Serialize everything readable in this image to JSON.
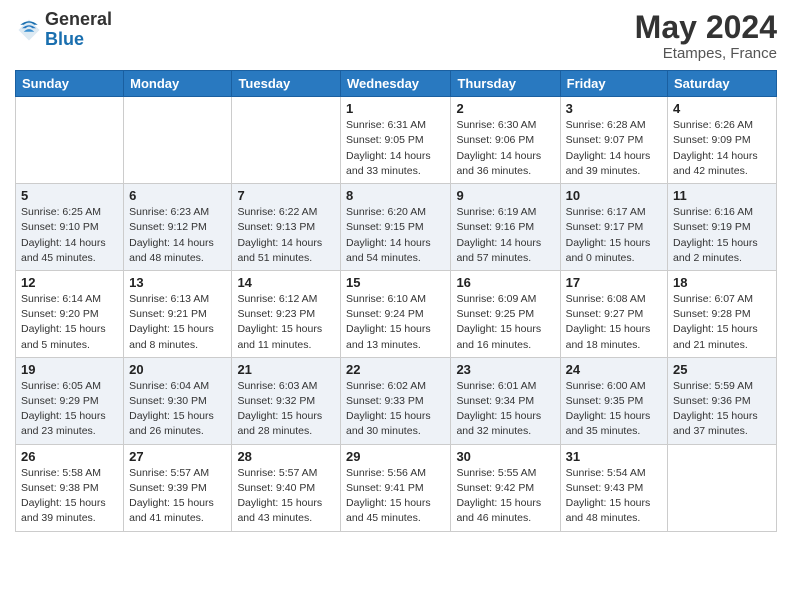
{
  "logo": {
    "general": "General",
    "blue": "Blue"
  },
  "header": {
    "month_year": "May 2024",
    "location": "Etampes, France"
  },
  "weekdays": [
    "Sunday",
    "Monday",
    "Tuesday",
    "Wednesday",
    "Thursday",
    "Friday",
    "Saturday"
  ],
  "weeks": [
    [
      {
        "day": "",
        "sunrise": "",
        "sunset": "",
        "daylight": ""
      },
      {
        "day": "",
        "sunrise": "",
        "sunset": "",
        "daylight": ""
      },
      {
        "day": "",
        "sunrise": "",
        "sunset": "",
        "daylight": ""
      },
      {
        "day": "1",
        "sunrise": "Sunrise: 6:31 AM",
        "sunset": "Sunset: 9:05 PM",
        "daylight": "Daylight: 14 hours and 33 minutes."
      },
      {
        "day": "2",
        "sunrise": "Sunrise: 6:30 AM",
        "sunset": "Sunset: 9:06 PM",
        "daylight": "Daylight: 14 hours and 36 minutes."
      },
      {
        "day": "3",
        "sunrise": "Sunrise: 6:28 AM",
        "sunset": "Sunset: 9:07 PM",
        "daylight": "Daylight: 14 hours and 39 minutes."
      },
      {
        "day": "4",
        "sunrise": "Sunrise: 6:26 AM",
        "sunset": "Sunset: 9:09 PM",
        "daylight": "Daylight: 14 hours and 42 minutes."
      }
    ],
    [
      {
        "day": "5",
        "sunrise": "Sunrise: 6:25 AM",
        "sunset": "Sunset: 9:10 PM",
        "daylight": "Daylight: 14 hours and 45 minutes."
      },
      {
        "day": "6",
        "sunrise": "Sunrise: 6:23 AM",
        "sunset": "Sunset: 9:12 PM",
        "daylight": "Daylight: 14 hours and 48 minutes."
      },
      {
        "day": "7",
        "sunrise": "Sunrise: 6:22 AM",
        "sunset": "Sunset: 9:13 PM",
        "daylight": "Daylight: 14 hours and 51 minutes."
      },
      {
        "day": "8",
        "sunrise": "Sunrise: 6:20 AM",
        "sunset": "Sunset: 9:15 PM",
        "daylight": "Daylight: 14 hours and 54 minutes."
      },
      {
        "day": "9",
        "sunrise": "Sunrise: 6:19 AM",
        "sunset": "Sunset: 9:16 PM",
        "daylight": "Daylight: 14 hours and 57 minutes."
      },
      {
        "day": "10",
        "sunrise": "Sunrise: 6:17 AM",
        "sunset": "Sunset: 9:17 PM",
        "daylight": "Daylight: 15 hours and 0 minutes."
      },
      {
        "day": "11",
        "sunrise": "Sunrise: 6:16 AM",
        "sunset": "Sunset: 9:19 PM",
        "daylight": "Daylight: 15 hours and 2 minutes."
      }
    ],
    [
      {
        "day": "12",
        "sunrise": "Sunrise: 6:14 AM",
        "sunset": "Sunset: 9:20 PM",
        "daylight": "Daylight: 15 hours and 5 minutes."
      },
      {
        "day": "13",
        "sunrise": "Sunrise: 6:13 AM",
        "sunset": "Sunset: 9:21 PM",
        "daylight": "Daylight: 15 hours and 8 minutes."
      },
      {
        "day": "14",
        "sunrise": "Sunrise: 6:12 AM",
        "sunset": "Sunset: 9:23 PM",
        "daylight": "Daylight: 15 hours and 11 minutes."
      },
      {
        "day": "15",
        "sunrise": "Sunrise: 6:10 AM",
        "sunset": "Sunset: 9:24 PM",
        "daylight": "Daylight: 15 hours and 13 minutes."
      },
      {
        "day": "16",
        "sunrise": "Sunrise: 6:09 AM",
        "sunset": "Sunset: 9:25 PM",
        "daylight": "Daylight: 15 hours and 16 minutes."
      },
      {
        "day": "17",
        "sunrise": "Sunrise: 6:08 AM",
        "sunset": "Sunset: 9:27 PM",
        "daylight": "Daylight: 15 hours and 18 minutes."
      },
      {
        "day": "18",
        "sunrise": "Sunrise: 6:07 AM",
        "sunset": "Sunset: 9:28 PM",
        "daylight": "Daylight: 15 hours and 21 minutes."
      }
    ],
    [
      {
        "day": "19",
        "sunrise": "Sunrise: 6:05 AM",
        "sunset": "Sunset: 9:29 PM",
        "daylight": "Daylight: 15 hours and 23 minutes."
      },
      {
        "day": "20",
        "sunrise": "Sunrise: 6:04 AM",
        "sunset": "Sunset: 9:30 PM",
        "daylight": "Daylight: 15 hours and 26 minutes."
      },
      {
        "day": "21",
        "sunrise": "Sunrise: 6:03 AM",
        "sunset": "Sunset: 9:32 PM",
        "daylight": "Daylight: 15 hours and 28 minutes."
      },
      {
        "day": "22",
        "sunrise": "Sunrise: 6:02 AM",
        "sunset": "Sunset: 9:33 PM",
        "daylight": "Daylight: 15 hours and 30 minutes."
      },
      {
        "day": "23",
        "sunrise": "Sunrise: 6:01 AM",
        "sunset": "Sunset: 9:34 PM",
        "daylight": "Daylight: 15 hours and 32 minutes."
      },
      {
        "day": "24",
        "sunrise": "Sunrise: 6:00 AM",
        "sunset": "Sunset: 9:35 PM",
        "daylight": "Daylight: 15 hours and 35 minutes."
      },
      {
        "day": "25",
        "sunrise": "Sunrise: 5:59 AM",
        "sunset": "Sunset: 9:36 PM",
        "daylight": "Daylight: 15 hours and 37 minutes."
      }
    ],
    [
      {
        "day": "26",
        "sunrise": "Sunrise: 5:58 AM",
        "sunset": "Sunset: 9:38 PM",
        "daylight": "Daylight: 15 hours and 39 minutes."
      },
      {
        "day": "27",
        "sunrise": "Sunrise: 5:57 AM",
        "sunset": "Sunset: 9:39 PM",
        "daylight": "Daylight: 15 hours and 41 minutes."
      },
      {
        "day": "28",
        "sunrise": "Sunrise: 5:57 AM",
        "sunset": "Sunset: 9:40 PM",
        "daylight": "Daylight: 15 hours and 43 minutes."
      },
      {
        "day": "29",
        "sunrise": "Sunrise: 5:56 AM",
        "sunset": "Sunset: 9:41 PM",
        "daylight": "Daylight: 15 hours and 45 minutes."
      },
      {
        "day": "30",
        "sunrise": "Sunrise: 5:55 AM",
        "sunset": "Sunset: 9:42 PM",
        "daylight": "Daylight: 15 hours and 46 minutes."
      },
      {
        "day": "31",
        "sunrise": "Sunrise: 5:54 AM",
        "sunset": "Sunset: 9:43 PM",
        "daylight": "Daylight: 15 hours and 48 minutes."
      },
      {
        "day": "",
        "sunrise": "",
        "sunset": "",
        "daylight": ""
      }
    ]
  ]
}
